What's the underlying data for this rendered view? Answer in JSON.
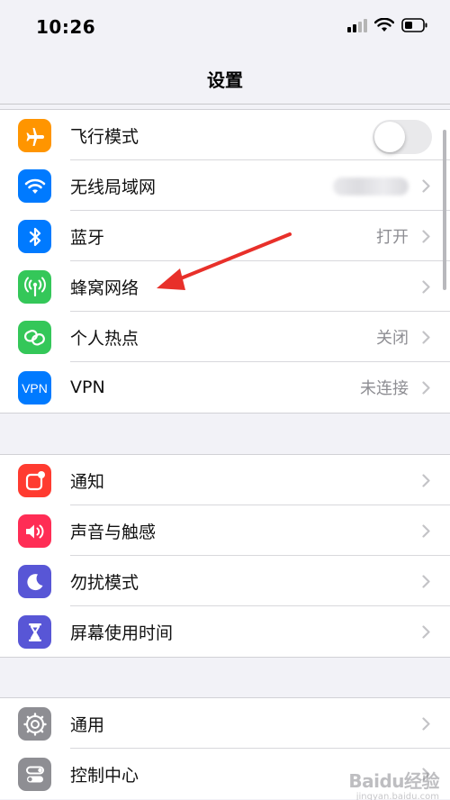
{
  "status_bar": {
    "time": "10:26"
  },
  "nav": {
    "title": "设置"
  },
  "groups": {
    "connectivity": [
      {
        "label": "飞行模式",
        "icon": "airplane-icon",
        "color": "#ff9500",
        "toggle": false
      },
      {
        "label": "无线局域网",
        "icon": "wifi-icon",
        "color": "#007aff",
        "value": ""
      },
      {
        "label": "蓝牙",
        "icon": "bluetooth-icon",
        "color": "#007aff",
        "value": "打开"
      },
      {
        "label": "蜂窝网络",
        "icon": "cellular-icon",
        "color": "#34c759",
        "value": ""
      },
      {
        "label": "个人热点",
        "icon": "hotspot-icon",
        "color": "#34c759",
        "value": "关闭"
      },
      {
        "label": "VPN",
        "icon": "vpn-icon",
        "icon_text": "VPN",
        "color": "#007aff",
        "value": "未连接"
      }
    ],
    "notifications": [
      {
        "label": "通知",
        "icon": "notifications-icon",
        "color": "#ff3b30"
      },
      {
        "label": "声音与触感",
        "icon": "sound-icon",
        "color": "#ff2d55"
      },
      {
        "label": "勿扰模式",
        "icon": "moon-icon",
        "color": "#5856d6"
      },
      {
        "label": "屏幕使用时间",
        "icon": "hourglass-icon",
        "color": "#5856d6"
      }
    ],
    "general": [
      {
        "label": "通用",
        "icon": "gear-icon",
        "color": "#8e8e93"
      },
      {
        "label": "控制中心",
        "icon": "control-center-icon",
        "color": "#8e8e93"
      }
    ]
  },
  "watermark": {
    "text": "Baidu经验",
    "sub": "jingyan.baidu.com"
  }
}
